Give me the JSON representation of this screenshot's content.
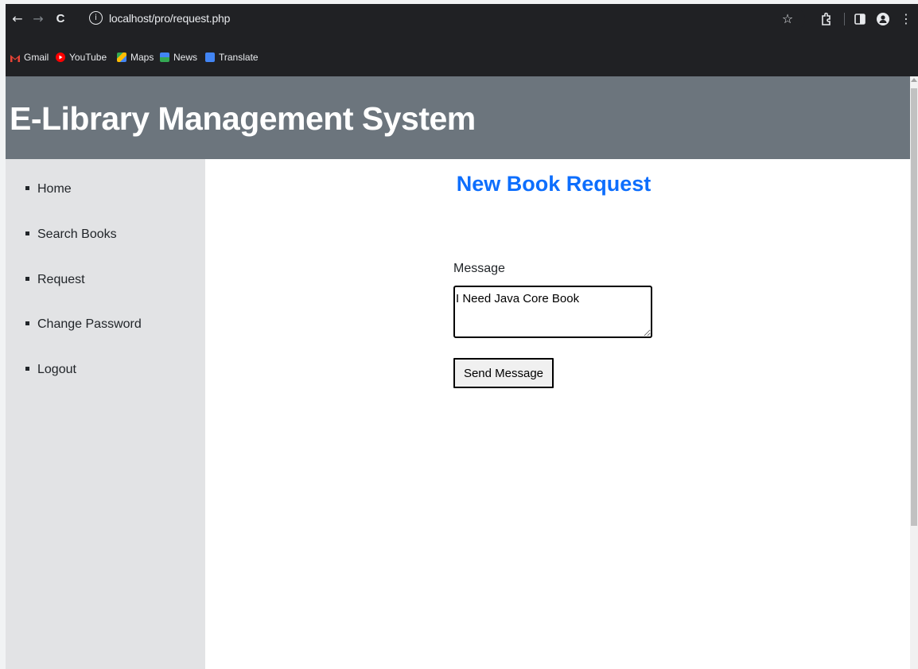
{
  "browser": {
    "url": "localhost/pro/request.php",
    "nav_icons": {
      "back": "←",
      "forward": "→",
      "reload": "C",
      "info": "i"
    },
    "toolbar_icons": {
      "bookmark": "☆",
      "extensions": "puzzle-icon",
      "side_panel": "side-panel-icon",
      "profile": "person-icon",
      "menu": "⋮"
    },
    "bookmarks": [
      {
        "label": "Gmail",
        "color": "#ea4335"
      },
      {
        "label": "YouTube",
        "color": "#ff0000"
      },
      {
        "label": "Maps",
        "color": "#34a853"
      },
      {
        "label": "News",
        "color": "#4285f4"
      },
      {
        "label": "Translate",
        "color": "#4285f4"
      }
    ]
  },
  "header": {
    "title": "E-Library Management System",
    "background": "#6c757d"
  },
  "sidebar": {
    "items": [
      {
        "label": "Home"
      },
      {
        "label": "Search Books"
      },
      {
        "label": "Request"
      },
      {
        "label": "Change Password"
      },
      {
        "label": "Logout"
      }
    ]
  },
  "main": {
    "title": "New Book Request",
    "title_color": "#0d6efd",
    "message_label": "Message",
    "message_value": "I Need Java Core Book",
    "send_label": "Send Message"
  }
}
